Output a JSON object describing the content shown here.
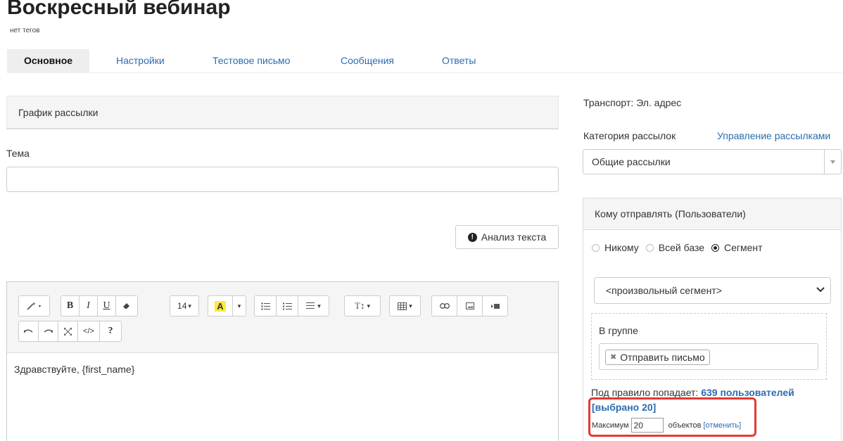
{
  "page": {
    "title": "Воскресный вебинар",
    "tags": "нет тегов"
  },
  "tabs": [
    {
      "label": "Основное",
      "active": true
    },
    {
      "label": "Настройки",
      "active": false
    },
    {
      "label": "Тестовое письмо",
      "active": false
    },
    {
      "label": "Сообщения",
      "active": false
    },
    {
      "label": "Ответы",
      "active": false
    }
  ],
  "schedule": {
    "title": "График рассылки"
  },
  "subject": {
    "label": "Тема",
    "value": "",
    "placeholder": ""
  },
  "analyze_button": {
    "label": "Анализ текста",
    "icon": "exclamation-circle-icon"
  },
  "editor": {
    "toolbar": {
      "font_size": "14",
      "icons": [
        "magic-wand-icon",
        "bold-icon",
        "italic-icon",
        "underline-icon",
        "eraser-icon",
        "font-size-icon",
        "text-color-icon",
        "unordered-list-icon",
        "ordered-list-icon",
        "align-icon",
        "line-height-icon",
        "table-icon",
        "link-icon",
        "image-icon",
        "video-icon",
        "undo-icon",
        "redo-icon",
        "fullscreen-icon",
        "code-view-icon",
        "help-icon"
      ],
      "help_label": "?",
      "code_label": "</>",
      "color_letter": "A",
      "line_height_label": "T↕"
    },
    "body": "Здравствуйте, {first_name}"
  },
  "sidebar": {
    "transport": "Транспорт: Эл. адрес",
    "category_label": "Категория рассылок",
    "manage_link": "Управление рассылками",
    "category_value": "Общие рассылки",
    "recipients": {
      "title": "Кому отправлять (Пользователи)",
      "options": [
        {
          "label": "Никому",
          "checked": false
        },
        {
          "label": "Всей базе",
          "checked": false
        },
        {
          "label": "Сегмент",
          "checked": true
        }
      ],
      "segment_select": "<произвольный сегмент>",
      "group_label": "В группе",
      "group_chip": "Отправить письмо",
      "rule_prefix": "Под правило попадает:",
      "rule_count": "639 пользователей",
      "selected": "[выбрано 20]",
      "max_label": "Максимум",
      "max_value": "20",
      "objects_label": "объектов",
      "cancel_link": "[отменить]"
    }
  },
  "colors": {
    "link": "#2b6cb0",
    "highlight": "#e53935",
    "panel_bg": "#f5f5f5",
    "accent_yellow": "#ffeb3b"
  }
}
